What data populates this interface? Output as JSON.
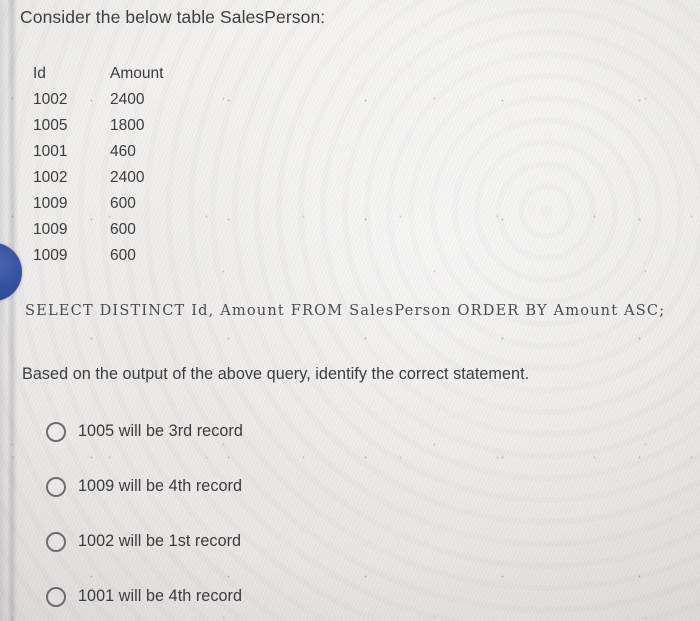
{
  "question": {
    "prompt": "Consider the below table SalesPerson:",
    "sub_prompt": "Based on the output of the above query, identify the correct statement.",
    "sql_query": "SELECT DISTINCT Id, Amount FROM SalesPerson ORDER BY Amount ASC;"
  },
  "table": {
    "name": "SalesPerson",
    "columns": [
      "Id",
      "Amount"
    ],
    "rows": [
      [
        "1002",
        "2400"
      ],
      [
        "1005",
        "1800"
      ],
      [
        "1001",
        "460"
      ],
      [
        "1002",
        "2400"
      ],
      [
        "1009",
        "600"
      ],
      [
        "1009",
        "600"
      ],
      [
        "1009",
        "600"
      ]
    ]
  },
  "options": [
    {
      "label": "1005 will be 3rd record",
      "selected": false
    },
    {
      "label": "1009 will be 4th record",
      "selected": false
    },
    {
      "label": "1002 will be 1st record",
      "selected": false
    },
    {
      "label": "1001 will be 4th record",
      "selected": false
    }
  ],
  "colors": {
    "page_background": "#efeeec",
    "body_text": "#3d3d3f",
    "sql_text": "#4b4b52",
    "radio_outline": "#6e6e72",
    "blue_marker": "#32519f"
  },
  "decorations": {
    "blue_marker": "blue-circle-marker"
  }
}
